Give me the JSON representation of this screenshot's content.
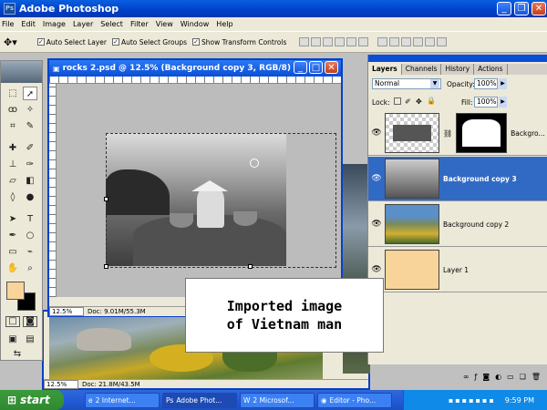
{
  "app": {
    "title": "Adobe Photoshop"
  },
  "menu": [
    "File",
    "Edit",
    "Image",
    "Layer",
    "Select",
    "Filter",
    "View",
    "Window",
    "Help"
  ],
  "options": {
    "auto_select_layer": "Auto Select Layer",
    "auto_select_groups": "Auto Select Groups",
    "show_transform_controls": "Show Transform Controls"
  },
  "doc_front": {
    "title": "rocks 2.psd @ 12.5% (Background copy 3, RGB/8)",
    "zoom": "12.5%",
    "doc_info": "Doc: 9.01M/55.3M"
  },
  "doc_back": {
    "zoom": "12.5%",
    "doc_info": "Doc: 21.8M/43.5M"
  },
  "layers_panel": {
    "tabs": [
      "Layers",
      "Channels",
      "History",
      "Actions"
    ],
    "blend_mode": "Normal",
    "opacity_label": "Opacity:",
    "opacity_value": "100%",
    "lock_label": "Lock:",
    "fill_label": "Fill:",
    "fill_value": "100%",
    "layers": [
      {
        "name": "Backgro...",
        "selected": false
      },
      {
        "name": "Background copy 3",
        "selected": true
      },
      {
        "name": "Background copy 2",
        "selected": false
      },
      {
        "name": "Layer 1",
        "selected": false
      }
    ]
  },
  "caption": {
    "line1": "Imported image",
    "line2": "of Vietnam man"
  },
  "taskbar": {
    "start": "start",
    "tasks": [
      "2 Internet...",
      "Adobe Phot...",
      "2 Microsof...",
      "Editor - Pho..."
    ],
    "clock": "9:59 PM"
  },
  "colors": {
    "xp_blue": "#0a4ed6",
    "selected_layer": "#316ac5",
    "layer1_fill": "#f8d49a",
    "foreground": "#f8d49a"
  }
}
